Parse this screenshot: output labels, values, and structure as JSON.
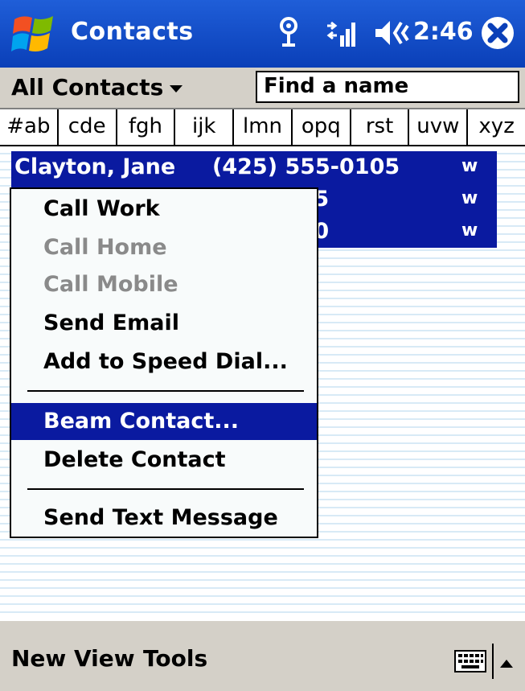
{
  "title_bar": {
    "title": "Contacts",
    "time": "2:46"
  },
  "filter": {
    "category": "All Contacts",
    "find_placeholder": "Find a name"
  },
  "alpha_tabs": [
    "#ab",
    "cde",
    "fgh",
    "ijk",
    "lmn",
    "opq",
    "rst",
    "uvw",
    "xyz"
  ],
  "contacts": [
    {
      "name": "Clayton, Jane",
      "phone": "(425) 555-0105",
      "tag": "w"
    },
    {
      "name": "",
      "phone": "5-0155",
      "tag": "w"
    },
    {
      "name": "",
      "phone": "5-0100",
      "tag": "w"
    }
  ],
  "context_menu": {
    "items": [
      {
        "label": "Call Work",
        "disabled": false
      },
      {
        "label": "Call Home",
        "disabled": true
      },
      {
        "label": "Call Mobile",
        "disabled": true
      },
      {
        "label": "Send Email",
        "disabled": false
      },
      {
        "label": "Add to Speed Dial...",
        "disabled": false
      },
      {
        "label": "Beam Contact...",
        "disabled": false,
        "selected": true
      },
      {
        "label": "Delete Contact",
        "disabled": false
      },
      {
        "label": "Send Text Message",
        "disabled": false
      }
    ]
  },
  "bottom_bar": {
    "new": "New",
    "view": "View",
    "tools": "Tools"
  },
  "colors": {
    "title_blue": "#0a3fb8",
    "selection_blue": "#0a1aa0",
    "chrome_gray": "#d4d0c8"
  }
}
